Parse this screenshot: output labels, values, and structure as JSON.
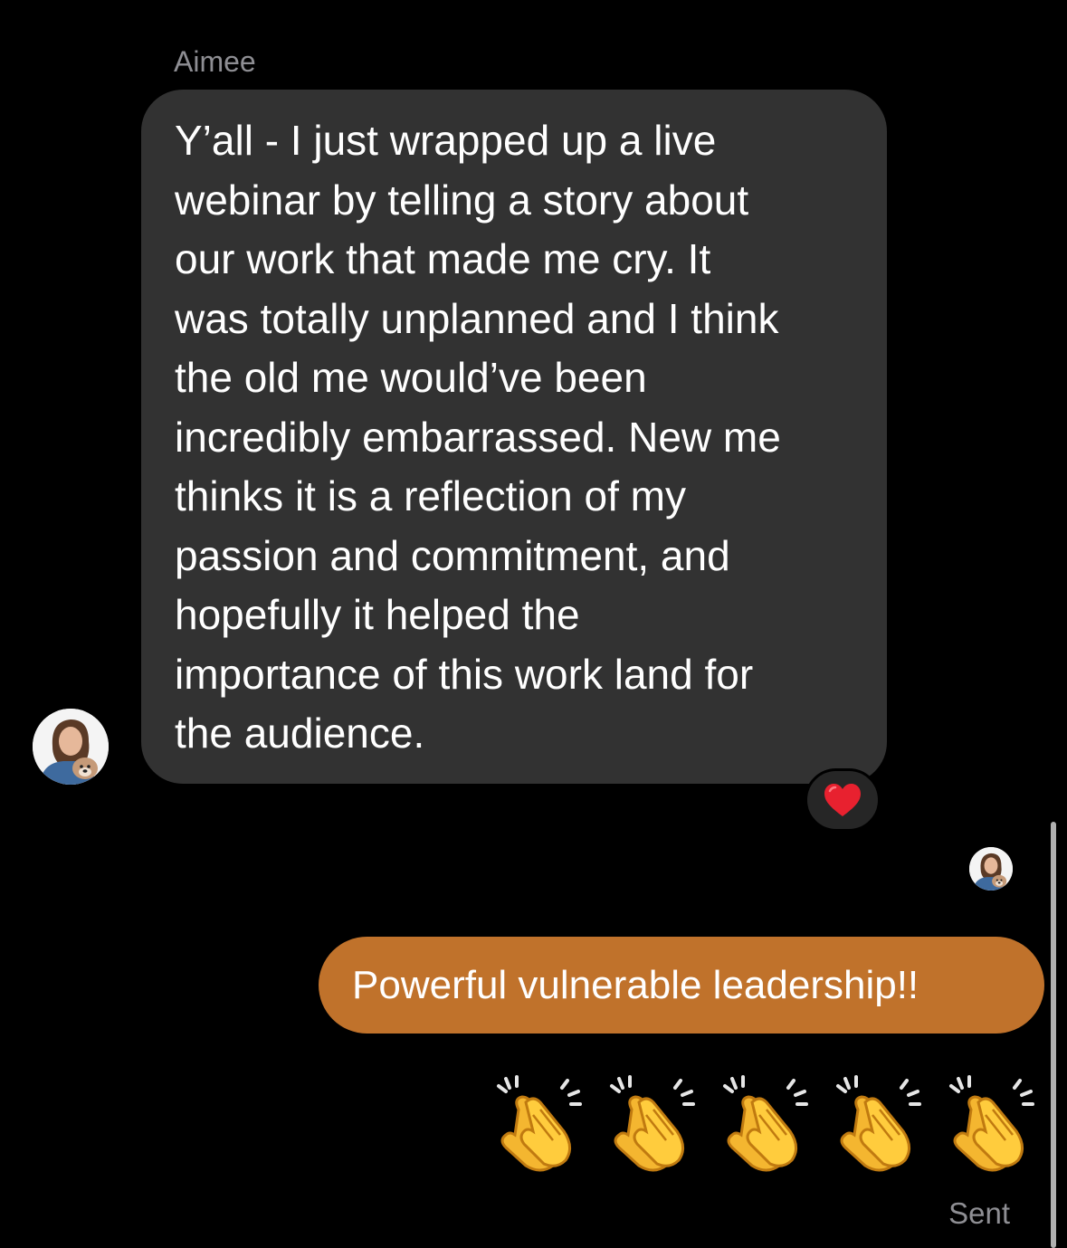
{
  "thread": {
    "sender_name": "Aimee",
    "incoming_message": "Y’all - I just wrapped up a live\nwebinar by telling a story about\nour work that made me cry. It\nwas totally unplanned and I think\nthe old me would’ve been\nincredibly embarrassed. New me\nthinks it is a reflection of my\npassion and commitment, and\nhopefully it helped the\nimportance of this work land for\nthe audience.",
    "reaction": "heart-icon",
    "outgoing_message": "Powerful vulnerable leadership!!",
    "outgoing_emoji": [
      "clapping-hands-icon",
      "clapping-hands-icon",
      "clapping-hands-icon",
      "clapping-hands-icon",
      "clapping-hands-icon"
    ],
    "status": "Sent"
  },
  "colors": {
    "background": "#000000",
    "incoming_bubble": "#323232",
    "outgoing_bubble": "#c0722b",
    "secondary_text": "#8e8e93",
    "heart": "#e8212f"
  }
}
